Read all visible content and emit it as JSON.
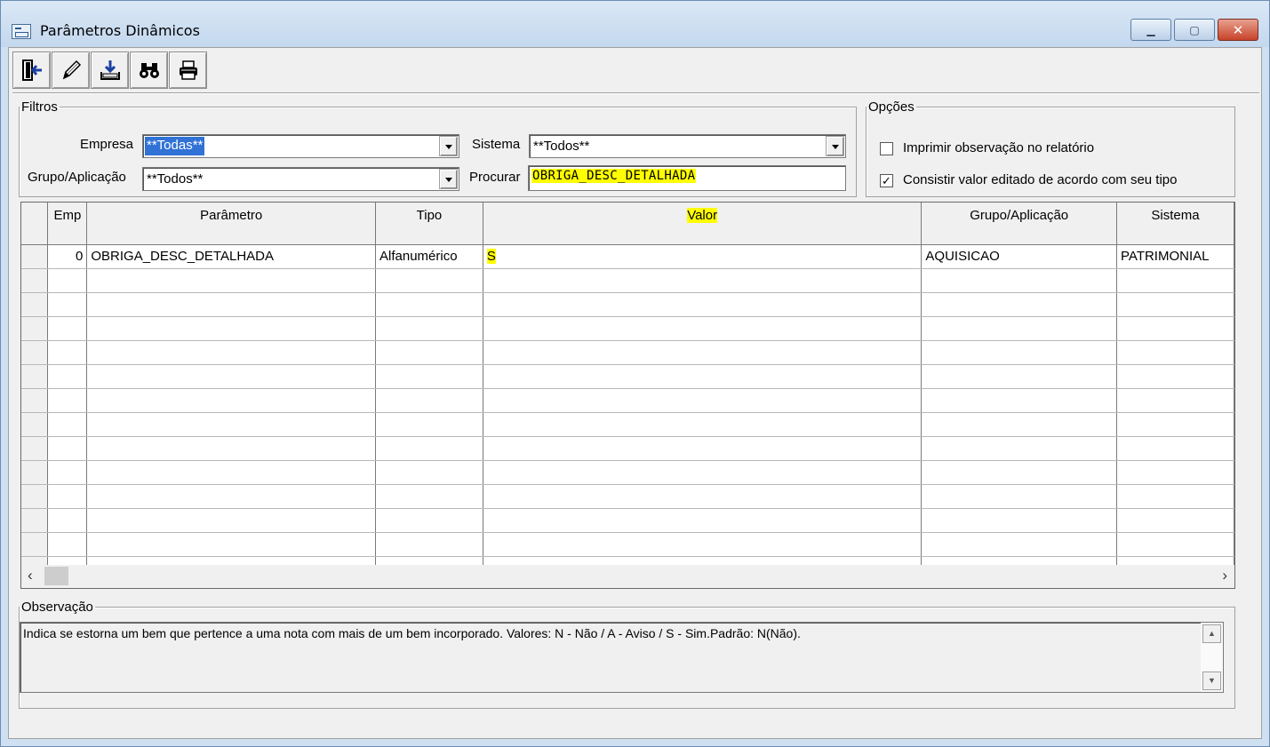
{
  "window": {
    "title": "Parâmetros Dinâmicos",
    "controls": {
      "minimize": "▭",
      "maximize": "□",
      "close": "✕"
    }
  },
  "toolbar": {
    "buttons": [
      {
        "name": "exit-button",
        "icon": "door-exit-icon",
        "glyph": "⇦"
      },
      {
        "name": "edit-button",
        "icon": "pencil-icon",
        "glyph": "✎"
      },
      {
        "name": "save-button",
        "icon": "tray-save-icon",
        "glyph": "⤓"
      },
      {
        "name": "find-button",
        "icon": "binoculars-icon",
        "glyph": "⚲"
      },
      {
        "name": "print-button",
        "icon": "printer-icon",
        "glyph": "⎙"
      }
    ]
  },
  "filtros": {
    "legend": "Filtros",
    "empresa_label": "Empresa",
    "empresa_value": "**Todas**",
    "grupo_label": "Grupo/Aplicação",
    "grupo_value": "**Todos**",
    "sistema_label": "Sistema",
    "sistema_value": "**Todos**",
    "procurar_label": "Procurar",
    "procurar_value": "OBRIGA_DESC_DETALHADA"
  },
  "opcoes": {
    "legend": "Opções",
    "imprimir_label": "Imprimir observação no relatório",
    "imprimir_checked": false,
    "consistir_label": "Consistir valor editado de acordo com seu tipo",
    "consistir_checked": true
  },
  "grid": {
    "columns": [
      "Emp",
      "Parâmetro",
      "Tipo",
      "Valor",
      "Grupo/Aplicação",
      "Sistema"
    ],
    "rows": [
      [
        "0",
        "OBRIGA_DESC_DETALHADA",
        "Alfanumérico",
        "S",
        "AQUISICAO",
        "PATRIMONIAL"
      ]
    ]
  },
  "scrollbar": {
    "left": "‹",
    "right": "›"
  },
  "observacao": {
    "legend": "Observação",
    "text": "Indica se estorna um bem que pertence a uma nota com mais de um bem incorporado. Valores: N - Não / A - Aviso / S - Sim.Padrão: N(Não)."
  }
}
